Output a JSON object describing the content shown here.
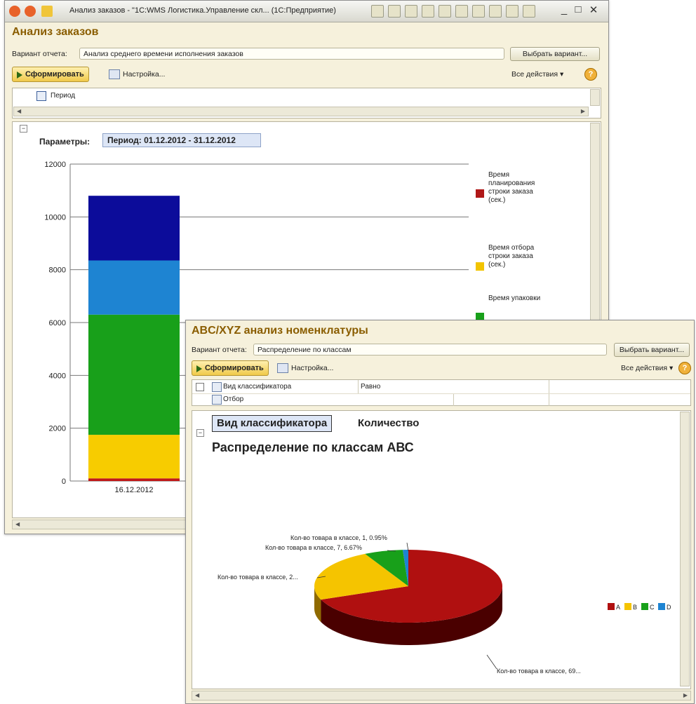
{
  "window1": {
    "title": "Анализ заказов - \"1С:WMS Логистика.Управление скл... (1С:Предприятие)",
    "title_controls": {
      "minimize": "_",
      "restore": "□",
      "close": "✕"
    },
    "header": "Анализ заказов",
    "variant_label": "Вариант отчета:",
    "variant_value": "Анализ среднего времени исполнения заказов",
    "choose_variant": "Выбрать вариант...",
    "generate": "Сформировать",
    "settings": "Настройка...",
    "all_actions": "Все действия ▾",
    "help": "?",
    "period_row": "Период",
    "params_label": "Параметры:",
    "params_value": "Период: 01.12.2012 - 31.12.2012",
    "chart_data": {
      "type": "bar",
      "stacked": true,
      "categories": [
        "16.12.2012"
      ],
      "ylim": [
        0,
        12000
      ],
      "yticks": [
        0,
        2000,
        4000,
        6000,
        8000,
        10000,
        12000
      ],
      "series": [
        {
          "name": "",
          "values": [
            100
          ],
          "color": "#c01818"
        },
        {
          "name": "",
          "values": [
            1650
          ],
          "color": "#f7cc00"
        },
        {
          "name": "",
          "values": [
            4550
          ],
          "color": "#18a01a"
        },
        {
          "name": "",
          "values": [
            2050
          ],
          "color": "#1e84d2"
        },
        {
          "name": "",
          "values": [
            2450
          ],
          "color": "#0c0c9a"
        }
      ],
      "legend": [
        {
          "text": "Время планирования строки заказа (сек.)",
          "color": "#b01818"
        },
        {
          "text": "Время отбора строки заказа (сек.)",
          "color": "#f2c400"
        },
        {
          "text": "Время упаковки",
          "color": "#18a01a"
        }
      ],
      "grid": true
    }
  },
  "window2": {
    "header": "ABC/XYZ анализ номенклатуры",
    "variant_label": "Вариант отчета:",
    "variant_value": "Распределение по классам",
    "choose_variant": "Выбрать вариант...",
    "generate": "Сформировать",
    "settings": "Настройка...",
    "all_actions": "Все действия ▾",
    "help": "?",
    "filter_rows": [
      {
        "name": "Вид классификатора",
        "condition": "Равно"
      },
      {
        "name": "Отбор",
        "condition": ""
      }
    ],
    "col_header_1": "Вид классификатора",
    "col_header_2": "Количество",
    "report_title": "Распределение по классам АВС",
    "chart_data": {
      "type": "pie",
      "title": "Распределение по классам АВС",
      "slices": [
        {
          "name": "A",
          "value": 69,
          "color": "#b01010",
          "side": "#4a0000"
        },
        {
          "name": "B",
          "value": 23.4,
          "color": "#f5c400",
          "side": "#8f6a00"
        },
        {
          "name": "C",
          "value": 6.67,
          "color": "#18a01a",
          "side": "#0b5a0c"
        },
        {
          "name": "D",
          "value": 0.95,
          "color": "#1e84d2",
          "side": "#0f4a7a"
        }
      ],
      "labels": [
        "Кол-во товара в классе, 1, 0.95%",
        "Кол-во товара в классе, 7, 6.67%",
        "Кол-во товара в классе, 2...",
        "Кол-во товара в классе, 69..."
      ],
      "legend_position": "right"
    }
  }
}
